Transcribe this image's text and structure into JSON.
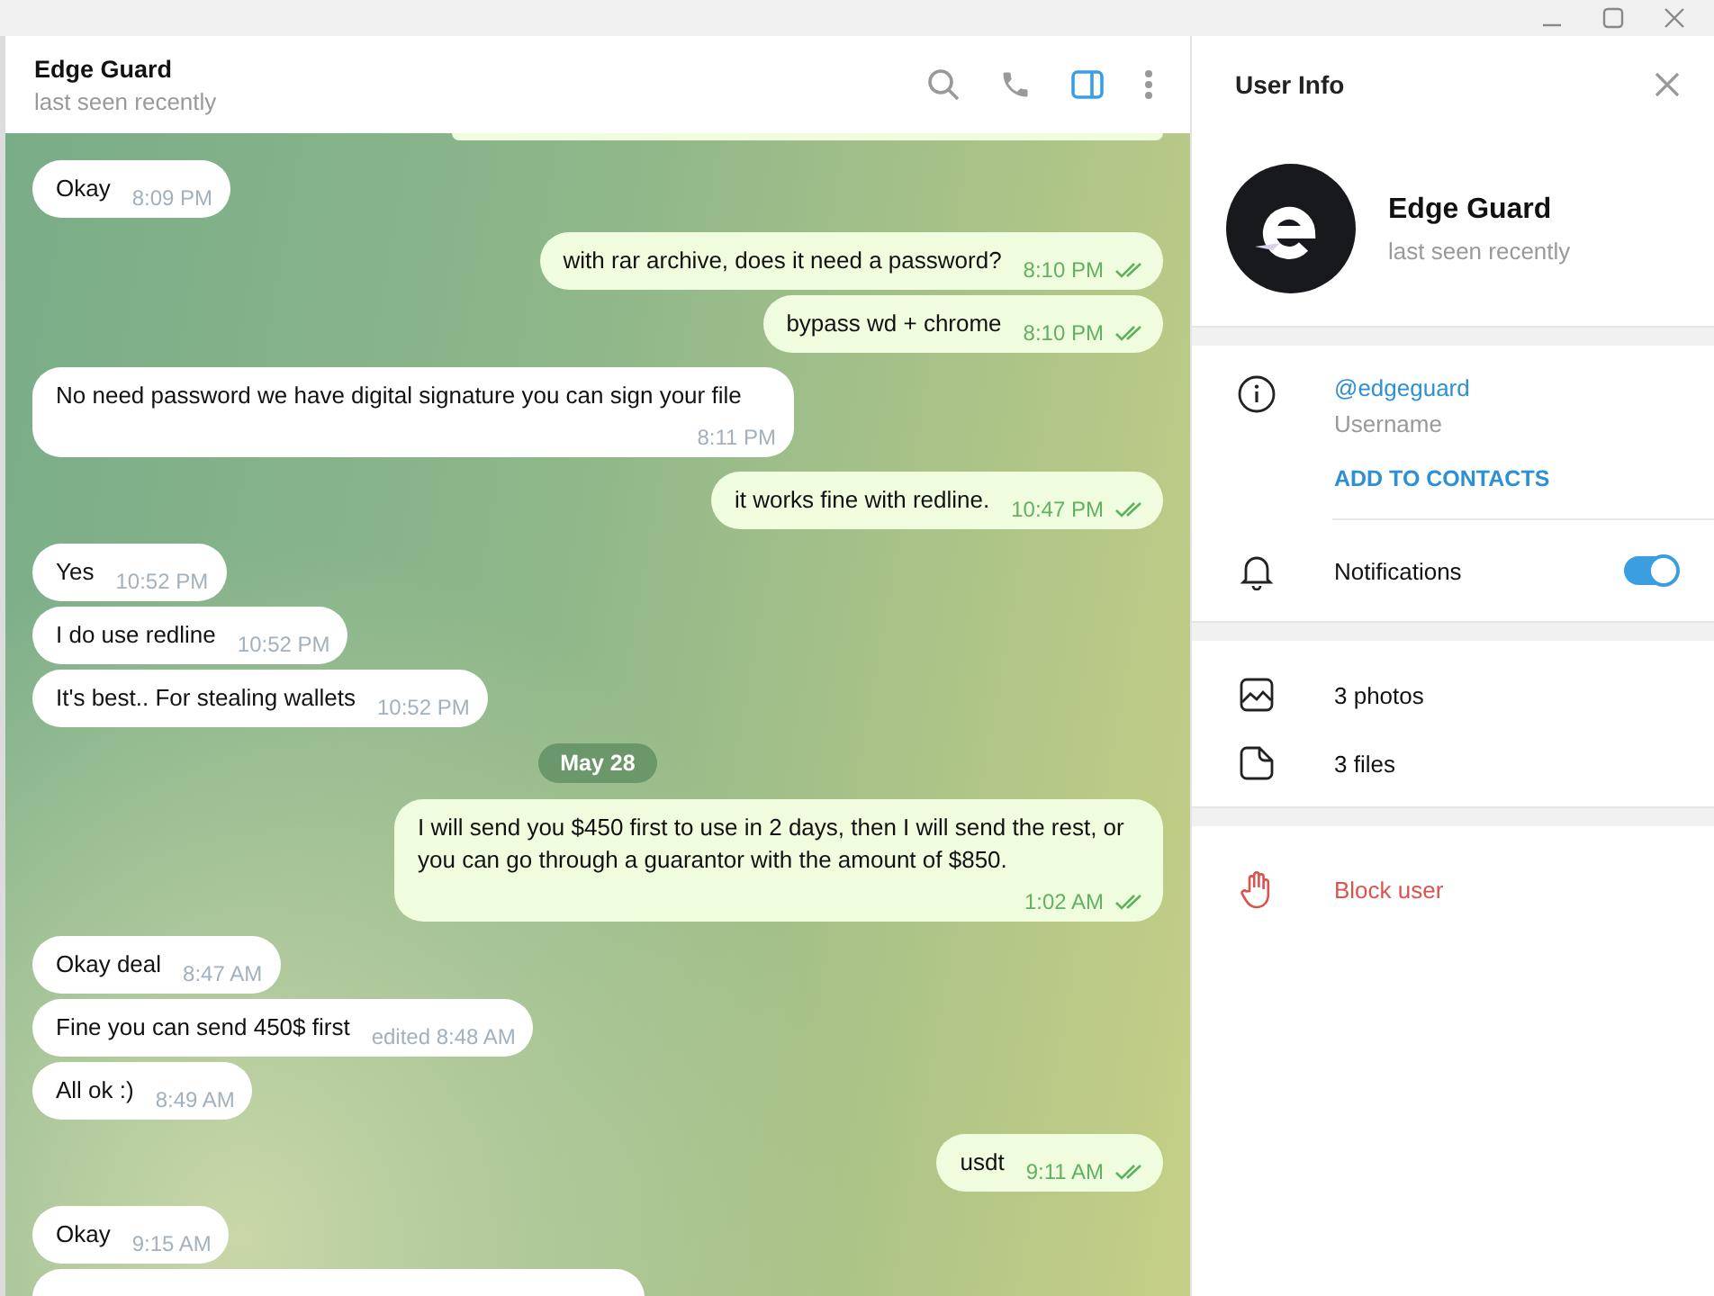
{
  "chat_header": {
    "name": "Edge Guard",
    "status": "last seen recently",
    "panel_toggle_selected": true
  },
  "messages": [
    {
      "kind": "cut"
    },
    {
      "kind": "in",
      "text": "Okay",
      "time": "8:09 PM"
    },
    {
      "kind": "out",
      "text": "with rar archive, does it need a password?",
      "time": "8:10 PM",
      "read": true
    },
    {
      "kind": "out",
      "text": "bypass wd + chrome",
      "time": "8:10 PM",
      "read": true
    },
    {
      "kind": "in",
      "text": "No need password we have digital signature you can sign your file",
      "time": "8:11 PM"
    },
    {
      "kind": "out",
      "text": "it works fine with redline.",
      "time": "10:47 PM",
      "read": true
    },
    {
      "kind": "in",
      "text": "Yes",
      "time": "10:52 PM"
    },
    {
      "kind": "in",
      "text": "I do use redline",
      "time": "10:52 PM"
    },
    {
      "kind": "in",
      "text": "It's best.. For stealing wallets",
      "time": "10:52 PM"
    },
    {
      "kind": "date",
      "text": "May 28"
    },
    {
      "kind": "out",
      "text": "I will send you $450 first to use in 2 days, then I will send the rest, or you can go through a guarantor with the amount of $850.",
      "time": "1:02 AM",
      "read": true
    },
    {
      "kind": "in",
      "text": "Okay deal",
      "time": "8:47 AM"
    },
    {
      "kind": "in",
      "text": "Fine you can send 450$ first",
      "time": "edited 8:48 AM"
    },
    {
      "kind": "in",
      "text": "All ok :)",
      "time": "8:49 AM"
    },
    {
      "kind": "out",
      "text": "usdt",
      "time": "9:11 AM",
      "read": true
    },
    {
      "kind": "in",
      "text": "Okay",
      "time": "9:15 AM"
    },
    {
      "kind": "in_cut"
    }
  ],
  "user_info": {
    "title": "User Info",
    "name": "Edge Guard",
    "status": "last seen recently",
    "username": "@edgeguard",
    "username_label": "Username",
    "add_contact": "ADD TO CONTACTS",
    "notifications": {
      "label": "Notifications",
      "on": true
    },
    "media": [
      "3 photos",
      "3 files"
    ],
    "block": "Block user"
  }
}
